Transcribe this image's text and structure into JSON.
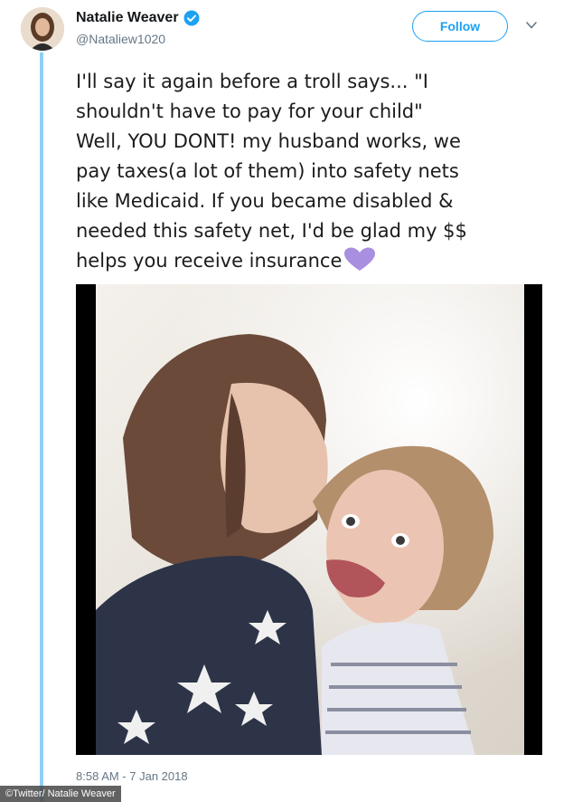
{
  "author": {
    "name": "Natalie Weaver",
    "handle": "@Nataliew1020",
    "verified": true
  },
  "follow_label": "Follow",
  "tweet": {
    "text": "I'll say it again before a troll says... \"I\nshouldn't have to pay for your child\"\nWell, YOU DONT! my husband works, we\npay taxes(a lot of them) into safety nets\nlike Medicaid. If you became disabled &\nneeded this safety net, I'd be glad my $$\nhelps you receive insurance",
    "emoji": "purple-heart"
  },
  "timestamp": "8:58 AM - 7 Jan 2018",
  "credit": "©Twitter/ Natalie Weaver",
  "colors": {
    "accent": "#1da1f2",
    "thread_line": "#8fd0f5",
    "heart": "#a98fe0"
  }
}
